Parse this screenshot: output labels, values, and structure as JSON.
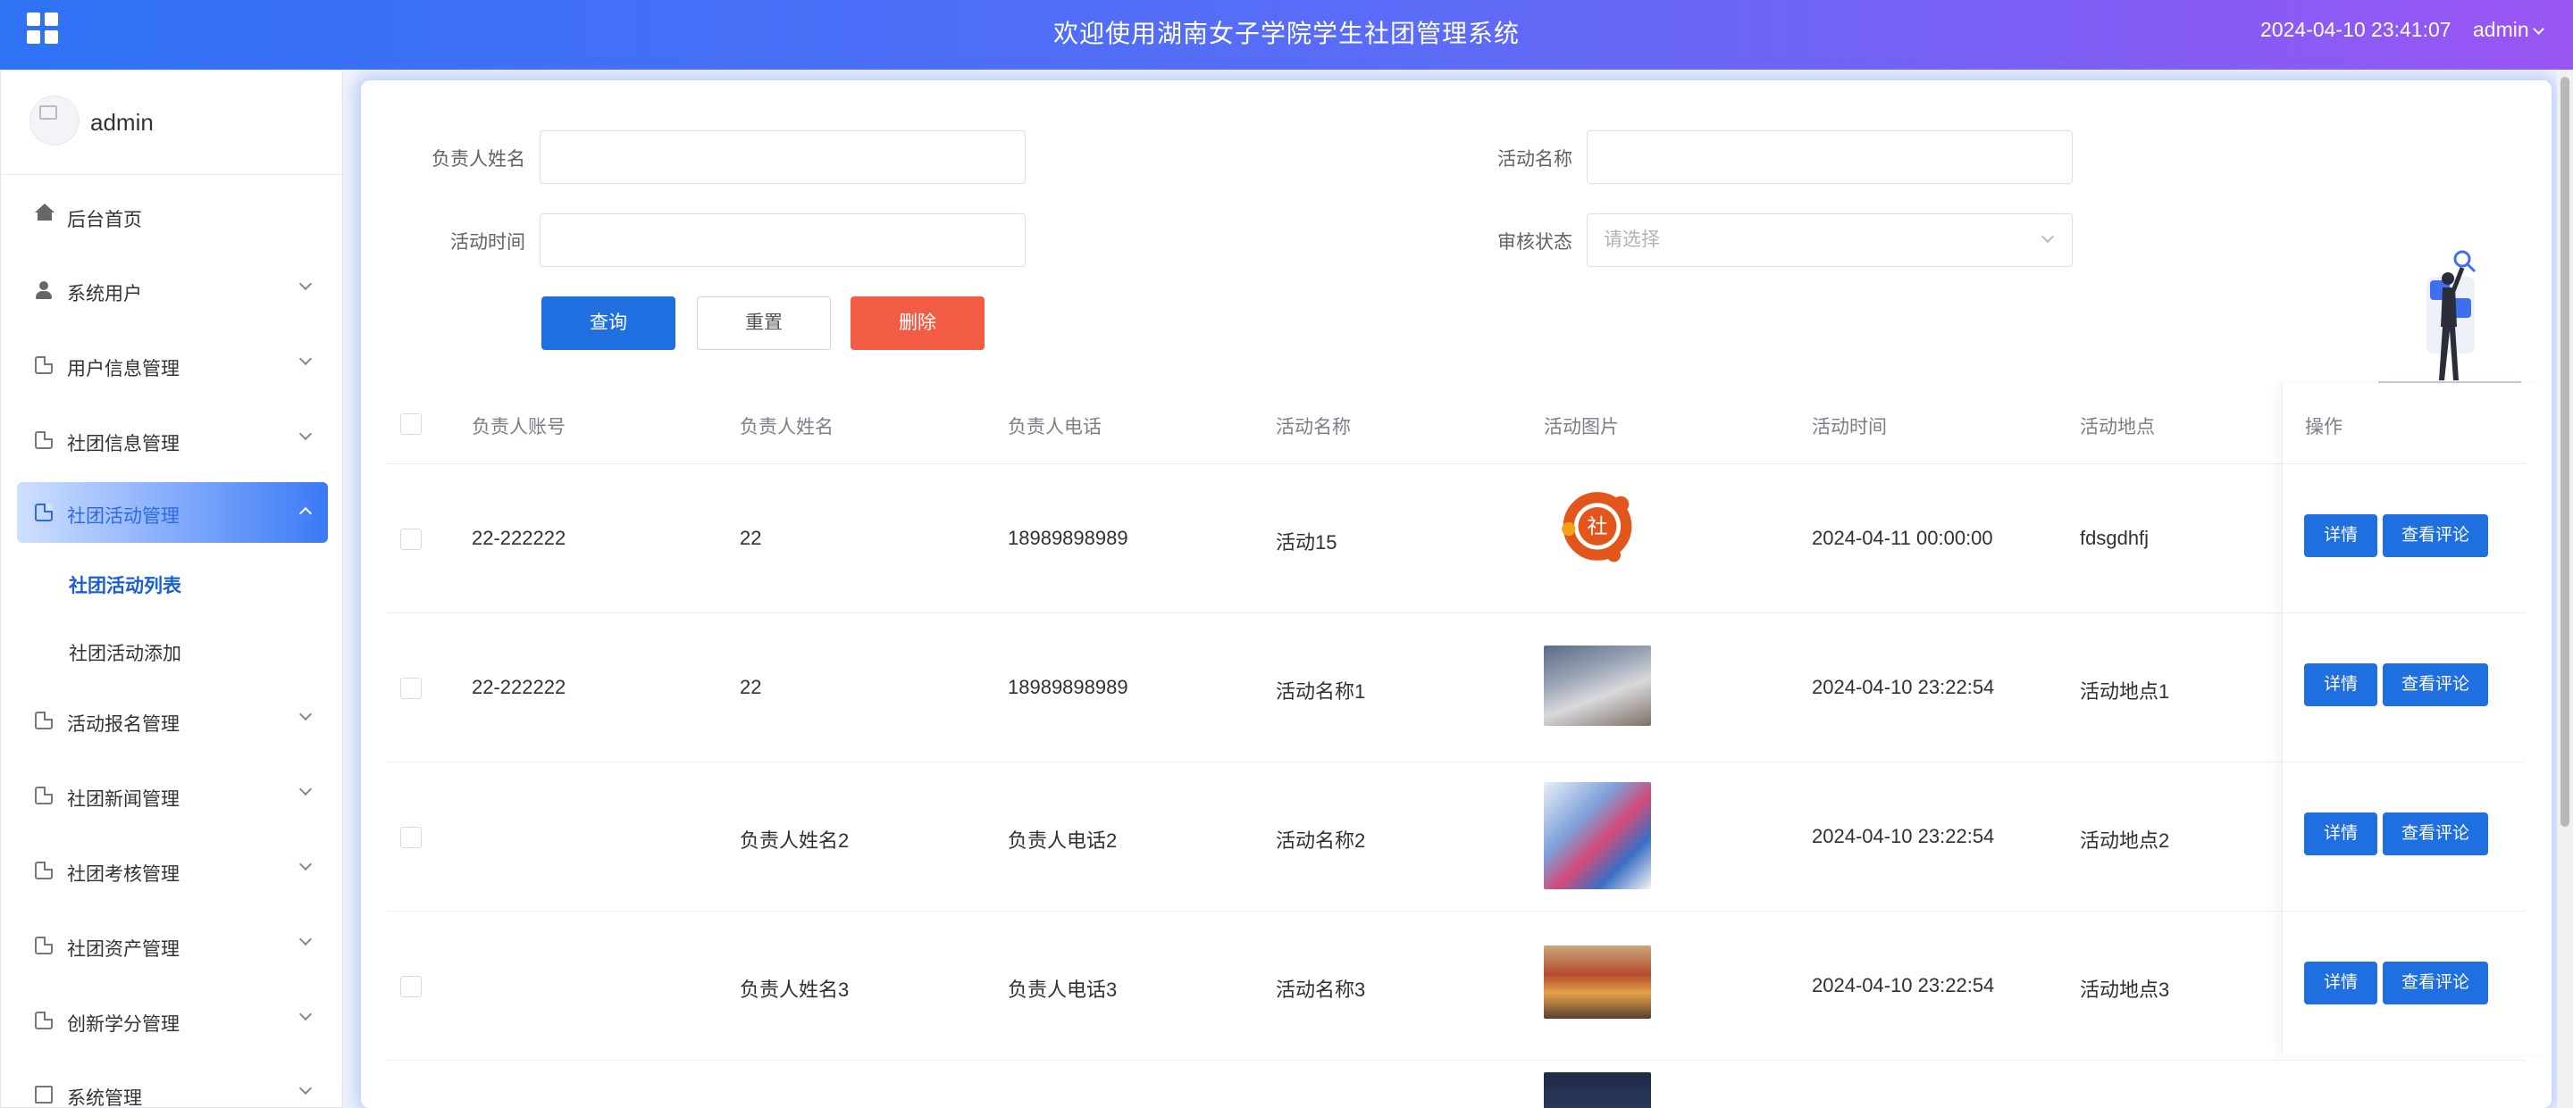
{
  "header": {
    "title": "欢迎使用湖南女子学院学生社团管理系统",
    "datetime": "2024-04-10 23:41:07",
    "user": "admin",
    "menu_icon": "grid-icon"
  },
  "sidebar": {
    "profile_name": "admin",
    "items": [
      {
        "label": "后台首页",
        "icon": "home-icon"
      },
      {
        "label": "系统用户",
        "icon": "user-icon"
      },
      {
        "label": "用户信息管理",
        "icon": "document-icon"
      },
      {
        "label": "社团信息管理",
        "icon": "document-icon"
      },
      {
        "label": "社团活动管理",
        "icon": "document-icon"
      },
      {
        "label": "活动报名管理",
        "icon": "document-icon"
      },
      {
        "label": "社团新闻管理",
        "icon": "document-icon"
      },
      {
        "label": "社团考核管理",
        "icon": "document-icon"
      },
      {
        "label": "社团资产管理",
        "icon": "document-icon"
      },
      {
        "label": "创新学分管理",
        "icon": "document-icon"
      },
      {
        "label": "系统管理",
        "icon": "image-icon"
      }
    ],
    "sub_items": [
      {
        "label": "社团活动列表"
      },
      {
        "label": "社团活动添加"
      }
    ]
  },
  "search": {
    "manager_name_label": "负责人姓名",
    "activity_name_label": "活动名称",
    "activity_time_label": "活动时间",
    "audit_status_label": "审核状态",
    "audit_status_placeholder": "请选择",
    "query_button": "查询",
    "reset_button": "重置",
    "delete_button": "删除"
  },
  "table": {
    "headers": [
      "负责人账号",
      "负责人姓名",
      "负责人电话",
      "活动名称",
      "活动图片",
      "活动时间",
      "活动地点",
      "操作"
    ],
    "rows": [
      {
        "account": "22-222222",
        "name": "22",
        "phone": "18989898989",
        "activity": "活动15",
        "image": "activity-logo-image",
        "time": "2024-04-11 00:00:00",
        "place": "fdsgdhfj"
      },
      {
        "account": "22-222222",
        "name": "22",
        "phone": "18989898989",
        "activity": "活动名称1",
        "image": "classroom-photo",
        "time": "2024-04-10 23:22:54",
        "place": "活动地点1"
      },
      {
        "account": "",
        "name": "负责人姓名2",
        "phone": "负责人电话2",
        "activity": "活动名称2",
        "image": "club-poster-image",
        "time": "2024-04-10 23:22:54",
        "place": "活动地点2"
      },
      {
        "account": "",
        "name": "负责人姓名3",
        "phone": "负责人电话3",
        "activity": "活动名称3",
        "image": "booth-photo",
        "time": "2024-04-10 23:22:54",
        "place": "活动地点3"
      }
    ],
    "detail_button": "详情",
    "comment_button": "查看评论"
  },
  "colors": {
    "header_start": "#2f72f6",
    "header_end": "#9a55f3",
    "primary": "#1f6fe0",
    "danger": "#f25c45"
  }
}
